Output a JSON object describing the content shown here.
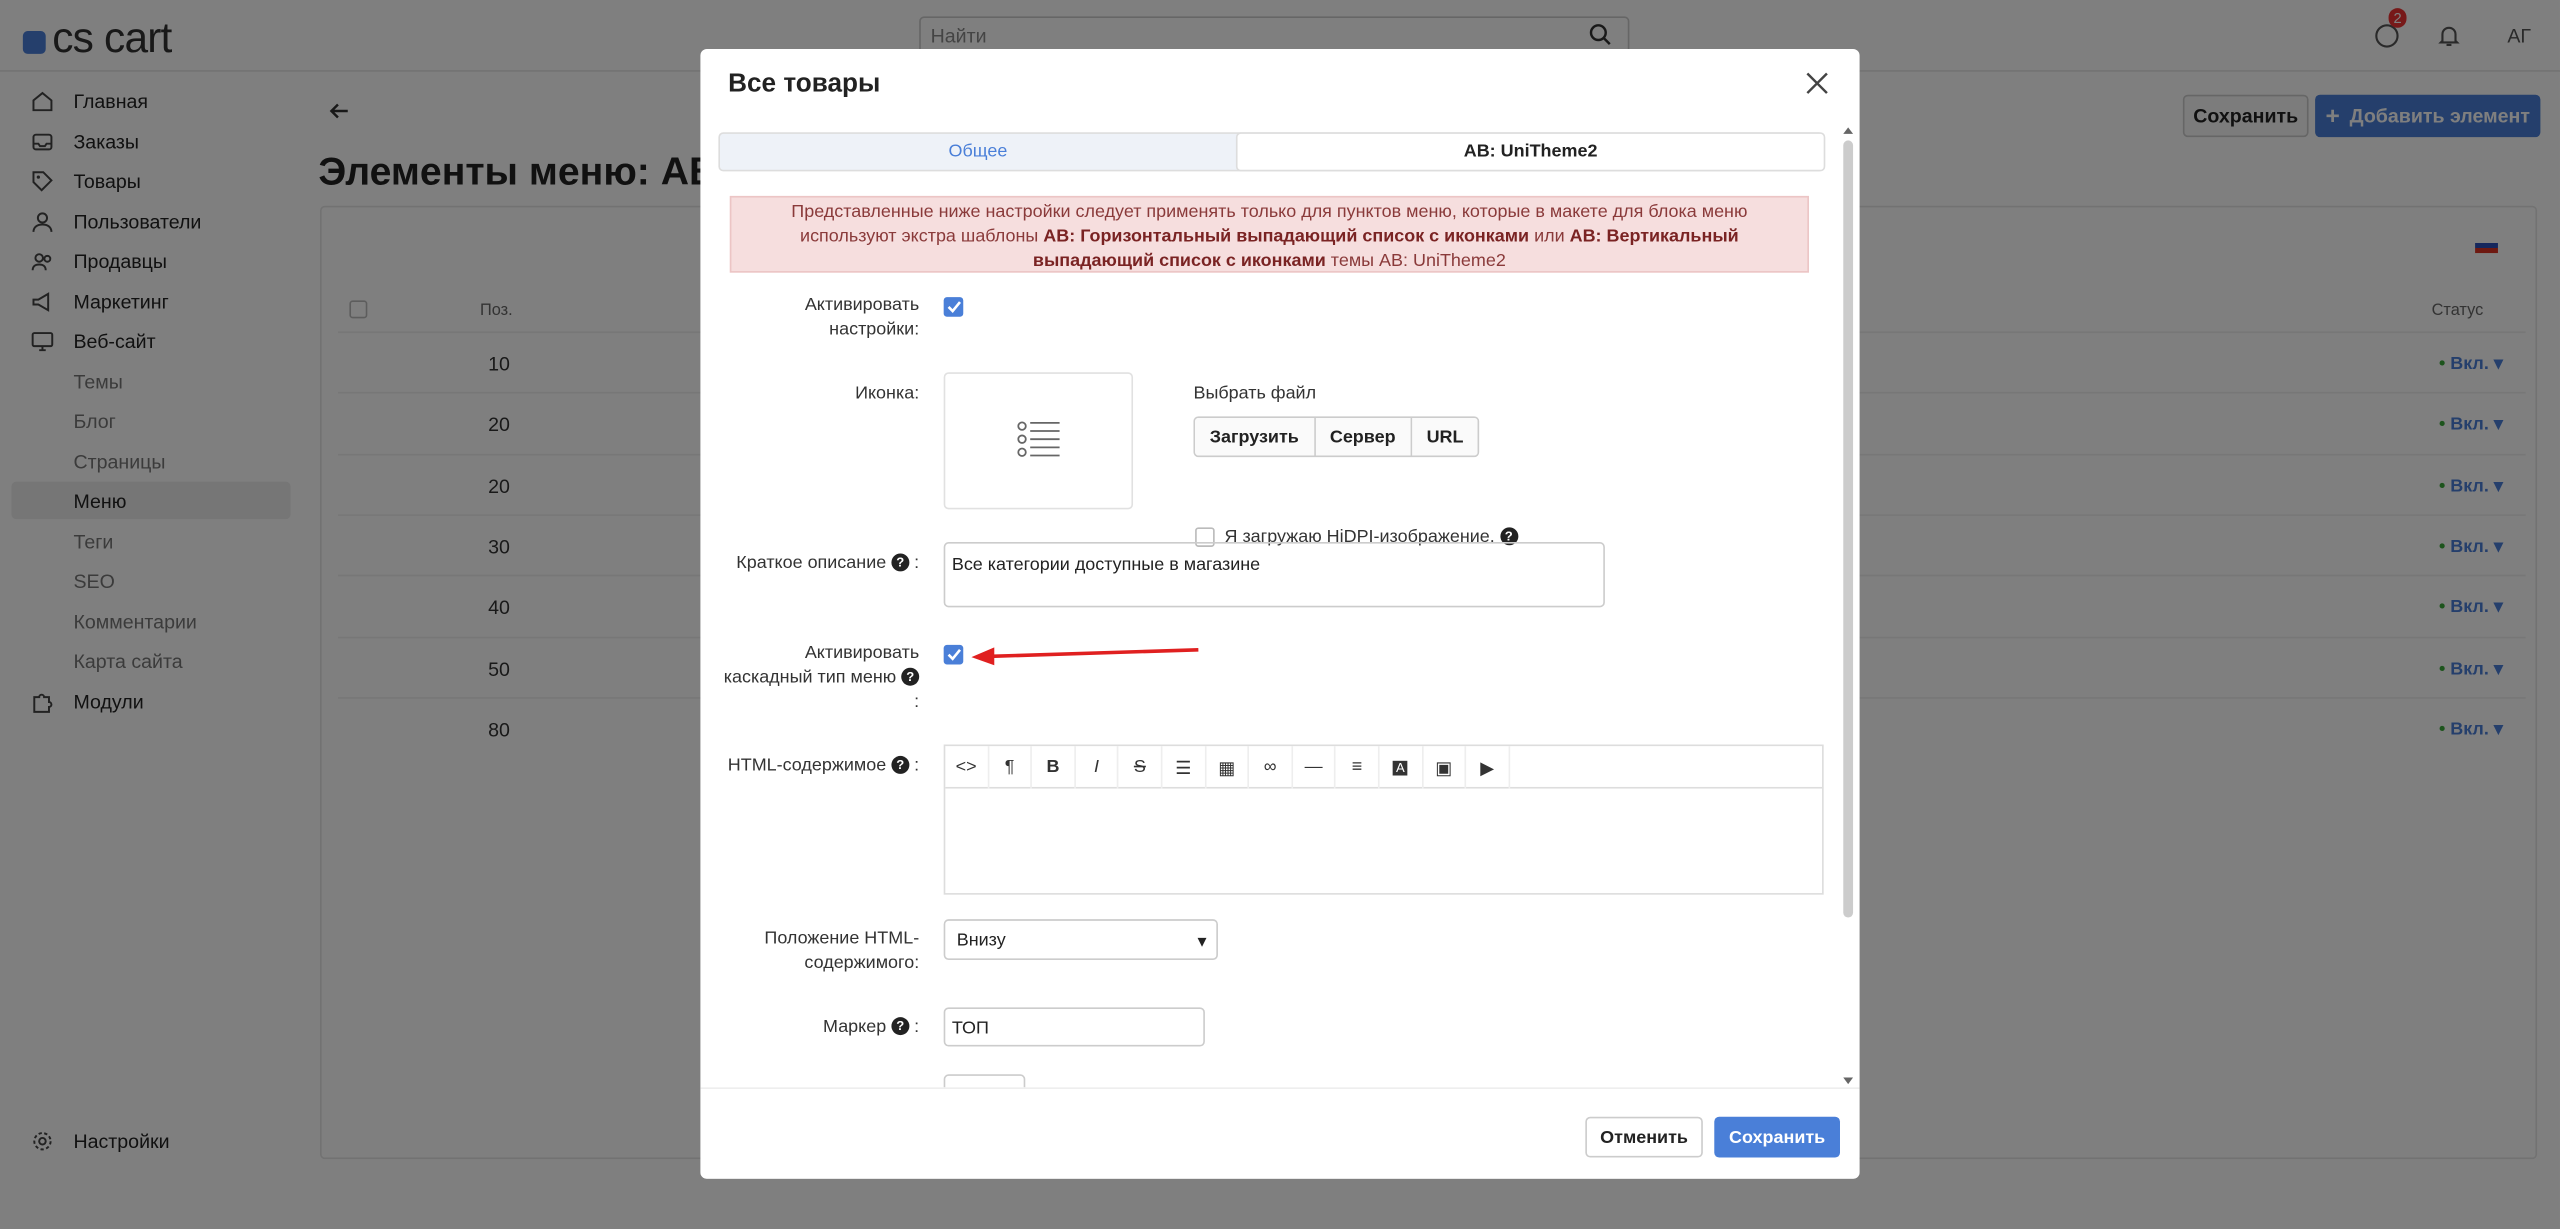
{
  "app": {
    "logo": "cs cart",
    "search_placeholder": "Найти",
    "notif_badge": "2",
    "user_initials": "АГ"
  },
  "sidebar": {
    "items": [
      {
        "label": "Главная",
        "icon": "home-icon"
      },
      {
        "label": "Заказы",
        "icon": "inbox-icon"
      },
      {
        "label": "Товары",
        "icon": "tag-icon"
      },
      {
        "label": "Пользователи",
        "icon": "user-icon"
      },
      {
        "label": "Продавцы",
        "icon": "users-icon"
      },
      {
        "label": "Маркетинг",
        "icon": "megaphone-icon"
      },
      {
        "label": "Веб-сайт",
        "icon": "monitor-icon"
      },
      {
        "label": "Темы"
      },
      {
        "label": "Блог"
      },
      {
        "label": "Страницы"
      },
      {
        "label": "Меню"
      },
      {
        "label": "Теги"
      },
      {
        "label": "SEO"
      },
      {
        "label": "Комментарии"
      },
      {
        "label": "Карта сайта"
      },
      {
        "label": "Модули",
        "icon": "puzzle-icon"
      }
    ],
    "settings": "Настройки"
  },
  "main": {
    "title": "Элементы меню: AB:",
    "save": "Сохранить",
    "add": "Добавить элемент",
    "columns": {
      "pos": "Поз.",
      "status": "Статус"
    },
    "rows": [
      {
        "pos": "10",
        "status": "Вкл."
      },
      {
        "pos": "20",
        "status": "Вкл."
      },
      {
        "pos": "20",
        "status": "Вкл."
      },
      {
        "pos": "30",
        "status": "Вкл."
      },
      {
        "pos": "40",
        "status": "Вкл."
      },
      {
        "pos": "50",
        "status": "Вкл."
      },
      {
        "pos": "80",
        "status": "Вкл."
      }
    ]
  },
  "modal": {
    "title": "Все товары",
    "tabs": [
      "Общее",
      "AB: UniTheme2"
    ],
    "alert": {
      "p1": "Представленные ниже настройки следует применять только для пунктов меню, которые в макете для блока меню используют экстра шаблоны ",
      "b1": "AB: Горизонтальный выпадающий список с иконками",
      "p2": " или ",
      "b2": "AB: Вертикальный выпадающий список с иконками",
      "p3": " темы AB: UniTheme2"
    },
    "activate_label": "Активировать настройки:",
    "icon_label": "Иконка:",
    "choose_file": "Выбрать файл",
    "upload_buttons": [
      "Загрузить",
      "Сервер",
      "URL"
    ],
    "hidpi_label": "Я загружаю HiDPI-изображение.",
    "short_desc_label": "Краткое описание",
    "short_desc_value": "Все категории доступные в магазине",
    "cascade_label_1": "Активировать",
    "cascade_label_2": "каскадный тип меню",
    "html_label": "HTML-содержимое",
    "html_pos_label": "Положение HTML-содержимого:",
    "html_pos_value": "Внизу",
    "marker_label": "Маркер",
    "marker_value": "ТОП",
    "cancel": "Отменить",
    "save": "Сохранить"
  },
  "colors": {
    "accent": "#4a7fd8",
    "alert_bg": "#f6dede",
    "arrow": "#e02020"
  }
}
